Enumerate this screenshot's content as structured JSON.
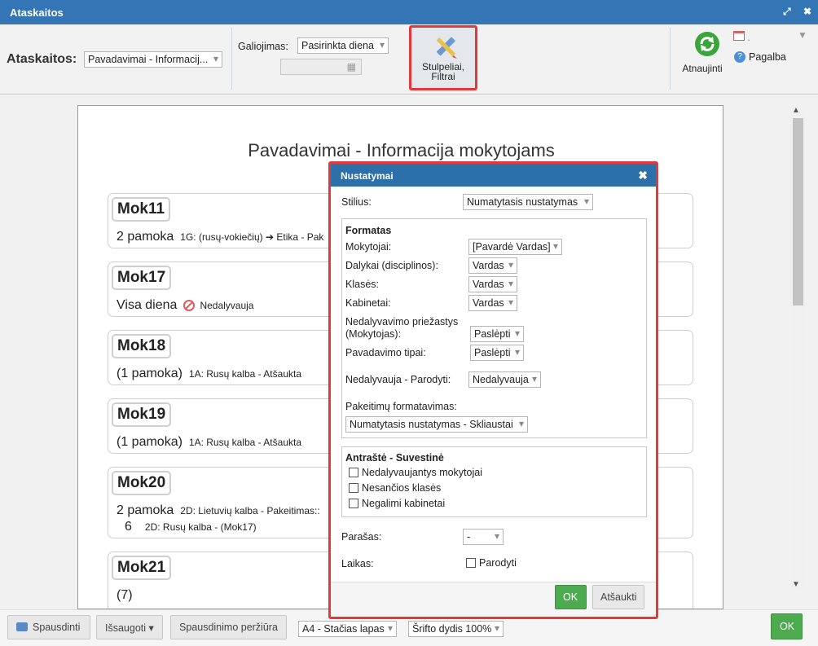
{
  "window": {
    "title": "Ataskaitos"
  },
  "toolbar": {
    "reports_label": "Ataskaitos:",
    "reports_select": "Pavadavimai - Informacij...",
    "validity_label": "Galiojimas:",
    "validity_select": "Pasirinkta diena",
    "columns_filters_line1": "Stulpeliai,",
    "columns_filters_line2": "Filtrai",
    "refresh_label": "Atnaujinti",
    "calendar_value": ".",
    "help_label": "Pagalba"
  },
  "report": {
    "title": "Pavadavimai - Informacija mokytojams",
    "cards": [
      {
        "name": "Mok11",
        "big": "2 pamoka",
        "detail": "1G: (rusų-vokiečių) ➔ Etika - Pak"
      },
      {
        "name": "Mok17",
        "big": "Visa diena",
        "detail": "Nedalyvauja"
      },
      {
        "name": "Mok18",
        "big": "(1 pamoka)",
        "detail": "1A: Rusų kalba - Atšaukta"
      },
      {
        "name": "Mok19",
        "big": "(1 pamoka)",
        "detail": "1A: Rusų kalba - Atšaukta"
      },
      {
        "name": "Mok20",
        "big": "2 pamoka",
        "detail": "2D: Lietuvių kalba - Pakeitimas::",
        "big2": "6",
        "detail2": "2D: Rusų kalba - (Mok17)"
      },
      {
        "name": "Mok21",
        "big": "(7)",
        "detail": ""
      }
    ]
  },
  "modal": {
    "title": "Nustatymai",
    "style_label": "Stilius:",
    "style_value": "Numatytasis nustatymas",
    "format_title": "Formatas",
    "teachers_label": "Mokytojai:",
    "teachers_value": "[Pavardė Vardas]",
    "subjects_label": "Dalykai (disciplinos):",
    "subjects_value": "Vardas",
    "classes_label": "Klasės:",
    "classes_value": "Vardas",
    "rooms_label": "Kabinetai:",
    "rooms_value": "Vardas",
    "absence_label_1": "Nedalyvavimo priežastys",
    "absence_label_2": "(Mokytojas):",
    "absence_value": "Paslėpti",
    "sub_types_label": "Pavadavimo tipai:",
    "sub_types_value": "Paslėpti",
    "absent_show_label": "Nedalyvauja - Parodyti:",
    "absent_show_value": "Nedalyvauja",
    "changes_format_label": "Pakeitimų formatavimas:",
    "changes_format_value": "Numatytasis nustatymas - Skliaustai",
    "header_title": "Antraštė - Suvestinė",
    "chk_absent_teachers": "Nedalyvaujantys mokytojai",
    "chk_absent_classes": "Nesančios klasės",
    "chk_unavailable_rooms": "Negalimi kabinetai",
    "signature_label": "Parašas:",
    "signature_value": "-",
    "time_label": "Laikas:",
    "time_show": "Parodyti",
    "ok": "OK",
    "cancel": "Atšaukti"
  },
  "bottombar": {
    "print": "Spausdinti",
    "save": "Išsaugoti ▾",
    "preview": "Spausdinimo peržiūra",
    "paper": "A4 - Stačias lapas",
    "font_size": "Šrifto dydis 100%",
    "ok": "OK"
  },
  "colors": {
    "titlebar": "#3476b5",
    "modal_header": "#2d6fa8",
    "highlight": "#e23a3a",
    "ok_green": "#4dab4f"
  }
}
